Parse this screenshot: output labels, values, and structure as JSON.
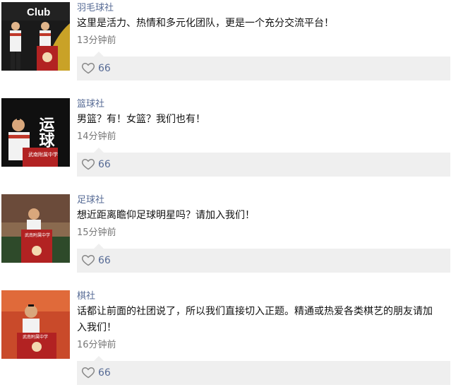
{
  "posts": [
    {
      "author": "羽毛球社",
      "text": "这里是活力、热情和多元化团队，更是一个充分交流平台！",
      "time": "13分钟前",
      "likes": "66",
      "thumb_caption": "Club"
    },
    {
      "author": "篮球社",
      "text": "男篮？有！女篮？我们也有！",
      "time": "14分钟前",
      "likes": "66",
      "thumb_caption": "运球"
    },
    {
      "author": "足球社",
      "text": "想近距离瞻仰足球明星吗？请加入我们！",
      "time": "15分钟前",
      "likes": "66",
      "thumb_caption": ""
    },
    {
      "author": "棋社",
      "text_line1": "话都让前面的社团说了，所以我们直接切入正题。精通或热爱各类棋艺的朋友请加",
      "text_line2": "入我们！",
      "time": "16分钟前",
      "likes": "66",
      "thumb_caption": ""
    }
  ],
  "icons": {
    "like": "heart-outline-icon"
  },
  "colors": {
    "link": "#576b95",
    "like_bg": "#efefef"
  }
}
